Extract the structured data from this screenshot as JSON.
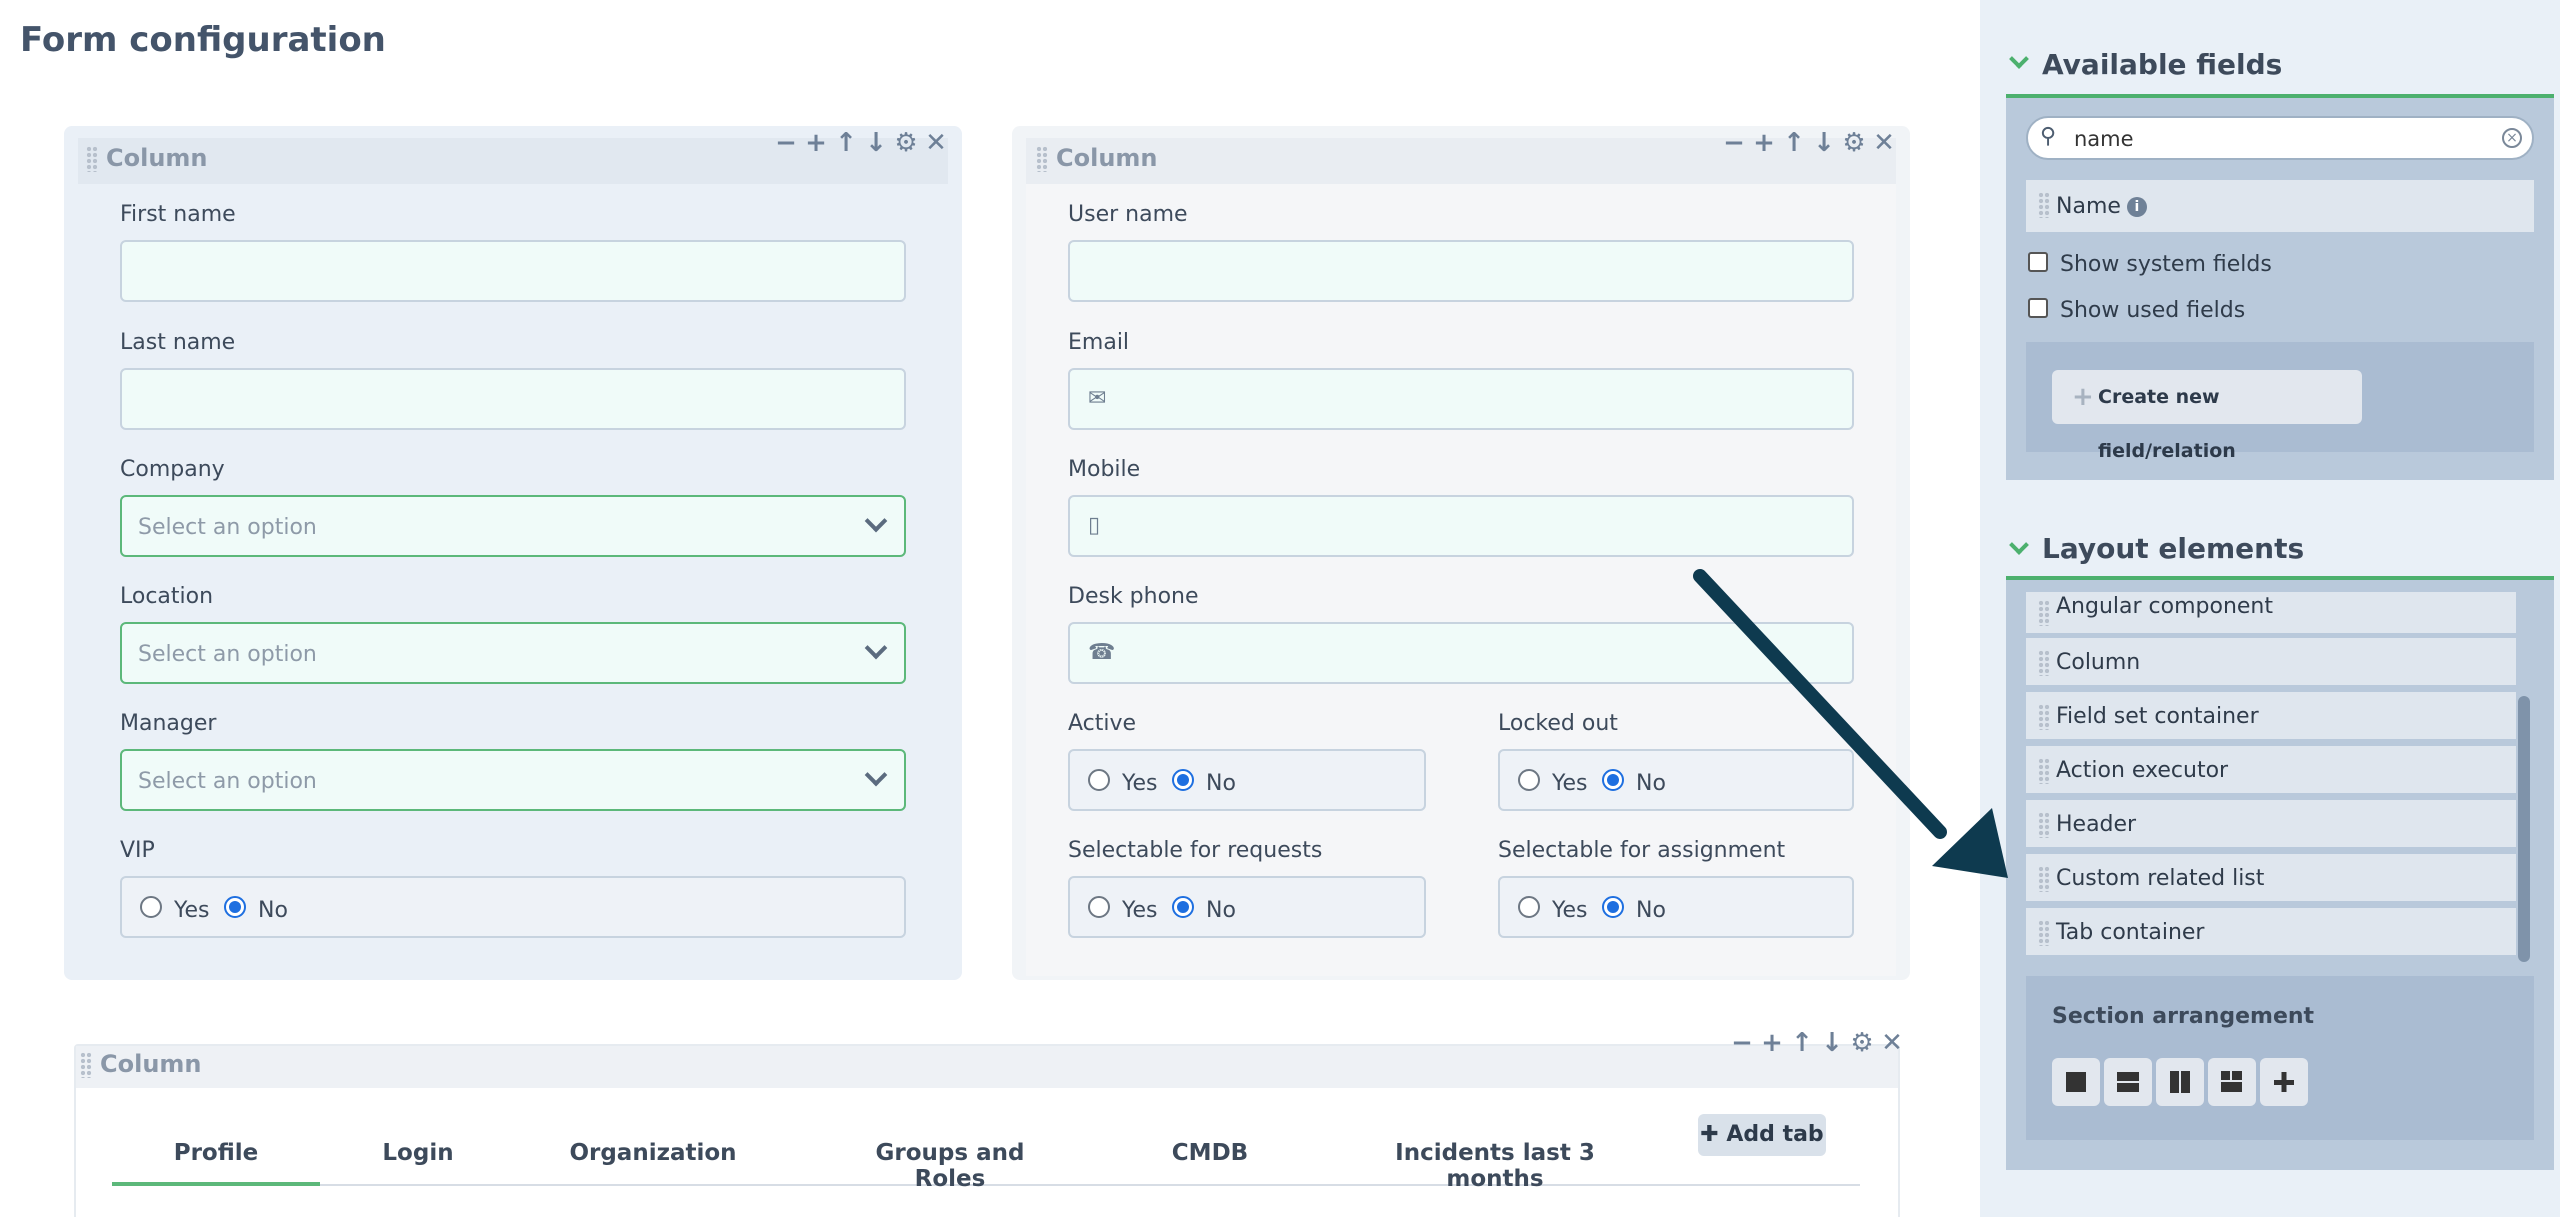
{
  "page": {
    "title": "Form configuration"
  },
  "column_label": "Column",
  "left_column": {
    "fields": [
      {
        "label": "First name"
      },
      {
        "label": "Last name"
      },
      {
        "label": "Company",
        "placeholder": "Select an option"
      },
      {
        "label": "Location",
        "placeholder": "Select an option"
      },
      {
        "label": "Manager",
        "placeholder": "Select an option"
      },
      {
        "label": "VIP",
        "options": [
          "Yes",
          "No"
        ],
        "selected": "No"
      }
    ]
  },
  "right_column": {
    "fields": [
      {
        "label": "User name"
      },
      {
        "label": "Email",
        "icon": "envelope-icon"
      },
      {
        "label": "Mobile",
        "icon": "mobile-phone-icon"
      },
      {
        "label": "Desk phone",
        "icon": "phone-icon"
      },
      {
        "label": "Active",
        "options": [
          "Yes",
          "No"
        ],
        "selected": "No"
      },
      {
        "label": "Locked out",
        "options": [
          "Yes",
          "No"
        ],
        "selected": "No"
      },
      {
        "label": "Selectable for requests",
        "options": [
          "Yes",
          "No"
        ],
        "selected": "No"
      },
      {
        "label": "Selectable for assignment",
        "options": [
          "Yes",
          "No"
        ],
        "selected": "No"
      }
    ]
  },
  "tabs": {
    "items": [
      "Profile",
      "Login",
      "Organization",
      "Groups and Roles",
      "CMDB",
      "Incidents last 3 months"
    ],
    "active": "Profile",
    "add_label": "Add tab"
  },
  "sidebar": {
    "available_fields": {
      "title": "Available fields",
      "search_value": "name",
      "results": [
        "Name"
      ],
      "show_system_fields": "Show system fields",
      "show_used_fields": "Show used fields",
      "create_label": "Create new field/relation"
    },
    "layout_elements": {
      "title": "Layout elements",
      "items": [
        "Angular component",
        "Column",
        "Field set container",
        "Action executor",
        "Header",
        "Custom related list",
        "Tab container"
      ],
      "arrangement_title": "Section arrangement"
    }
  },
  "colors": {
    "accent": "#5cb87a",
    "arrow": "#0e3a4f"
  }
}
